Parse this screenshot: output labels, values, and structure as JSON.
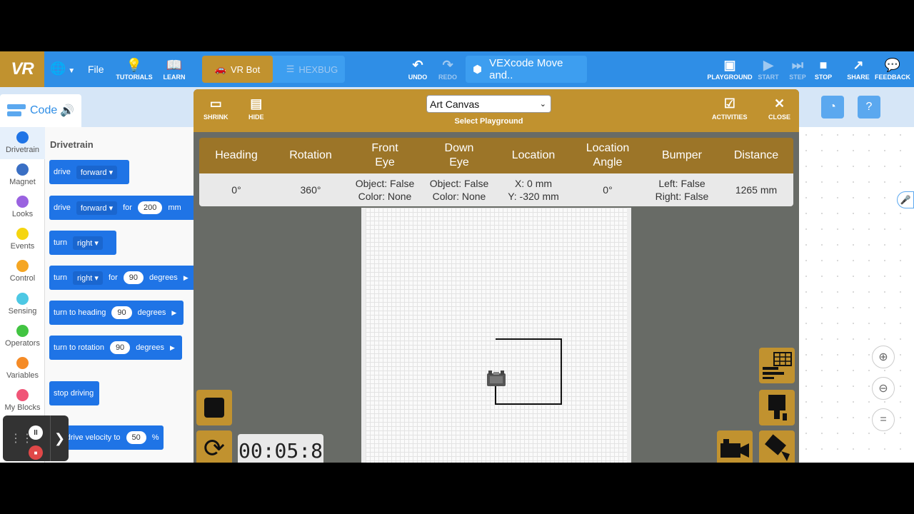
{
  "topbar": {
    "logo": "VR",
    "file": "File",
    "tutorials": "TUTORIALS",
    "learn": "LEARN",
    "robot_active": "VR Bot",
    "robot_other": "HEXBUG",
    "undo": "UNDO",
    "redo": "REDO",
    "project_name": "VEXcode Move and..",
    "playground": "PLAYGROUND",
    "start": "START",
    "step": "STEP",
    "stop": "STOP",
    "share": "SHARE",
    "feedback": "FEEDBACK"
  },
  "code_tab": {
    "label": "Code"
  },
  "categories": [
    {
      "label": "Drivetrain",
      "color": "#1f74e6"
    },
    {
      "label": "Magnet",
      "color": "#3a6fc4"
    },
    {
      "label": "Looks",
      "color": "#9a62e0"
    },
    {
      "label": "Events",
      "color": "#f5d50f"
    },
    {
      "label": "Control",
      "color": "#f5a623"
    },
    {
      "label": "Sensing",
      "color": "#4dc8e4"
    },
    {
      "label": "Operators",
      "color": "#42c442"
    },
    {
      "label": "Variables",
      "color": "#f58b26"
    },
    {
      "label": "My Blocks",
      "color": "#f05577"
    }
  ],
  "blocks": {
    "title": "Drivetrain",
    "b1": {
      "verb": "drive",
      "dir": "forward"
    },
    "b2": {
      "verb": "drive",
      "dir": "forward",
      "for": "for",
      "value": "200",
      "unit": "mm"
    },
    "b3": {
      "verb": "turn",
      "dir": "right"
    },
    "b4": {
      "verb": "turn",
      "dir": "right",
      "for": "for",
      "value": "90",
      "unit": "degrees"
    },
    "b5": {
      "text": "turn to heading",
      "value": "90",
      "unit": "degrees"
    },
    "b6": {
      "text": "turn to rotation",
      "value": "90",
      "unit": "degrees"
    },
    "b7": {
      "text": "stop driving"
    },
    "b8": {
      "text": "set drive velocity to",
      "value": "50",
      "unit": "%"
    }
  },
  "playground": {
    "shrink": "SHRINK",
    "hide": "HIDE",
    "selected": "Art Canvas",
    "select_label": "Select Playground",
    "activities": "ACTIVITIES",
    "close": "CLOSE",
    "timer": "00:05:8"
  },
  "telemetry": {
    "headers": [
      "Heading",
      "Rotation",
      "Front Eye",
      "Down Eye",
      "Location",
      "Location Angle",
      "Bumper",
      "Distance"
    ],
    "values": {
      "heading": "0°",
      "rotation": "360°",
      "front_eye_1": "Object: False",
      "front_eye_2": "Color: None",
      "down_eye_1": "Object: False",
      "down_eye_2": "Color: None",
      "location_x": "X: 0 mm",
      "location_y": "Y: -320 mm",
      "location_angle": "0°",
      "bumper_left": "Left: False",
      "bumper_right": "Right: False",
      "distance": "1265 mm"
    }
  }
}
